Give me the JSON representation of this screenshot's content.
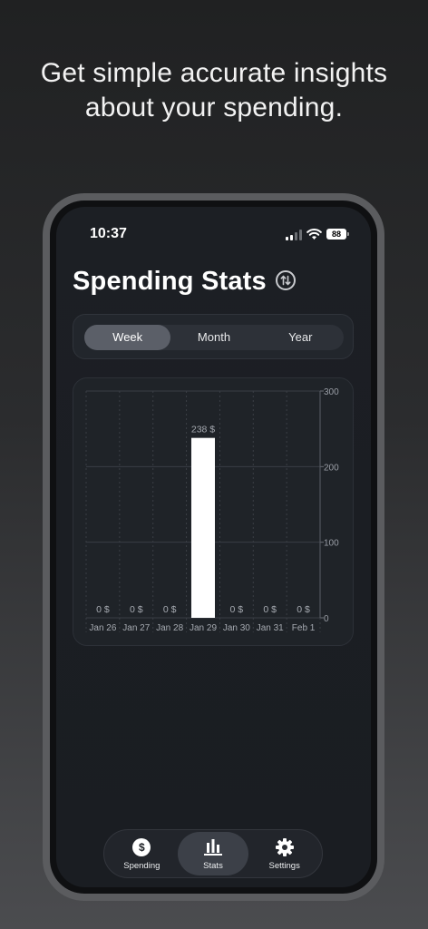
{
  "headline": {
    "line1": "Get simple accurate insights",
    "line2": "about your spending."
  },
  "status_bar": {
    "time": "10:37",
    "battery": "88"
  },
  "page_title": "Spending Stats",
  "segments": {
    "options": [
      "Week",
      "Month",
      "Year"
    ],
    "selected": "Week"
  },
  "chart_data": {
    "type": "bar",
    "categories": [
      "Jan 26",
      "Jan 27",
      "Jan 28",
      "Jan 29",
      "Jan 30",
      "Jan 31",
      "Feb 1"
    ],
    "values": [
      0,
      0,
      0,
      238,
      0,
      0,
      0
    ],
    "value_labels": [
      "0 $",
      "0 $",
      "0 $",
      "238 $",
      "0 $",
      "0 $",
      "0 $"
    ],
    "y_ticks": [
      "0",
      "100",
      "200",
      "300"
    ],
    "ylim": [
      0,
      300
    ],
    "grid": true,
    "bar_color": "#ffffff"
  },
  "tabbar": {
    "items": [
      {
        "label": "Spending",
        "icon": "dollar-circle-icon"
      },
      {
        "label": "Stats",
        "icon": "bar-chart-icon"
      },
      {
        "label": "Settings",
        "icon": "gear-icon"
      }
    ],
    "selected": "Stats"
  },
  "colors": {
    "accent_bar": "#ffffff",
    "card_bg": "#1f2328",
    "screen_bg": "#1b1e23"
  }
}
